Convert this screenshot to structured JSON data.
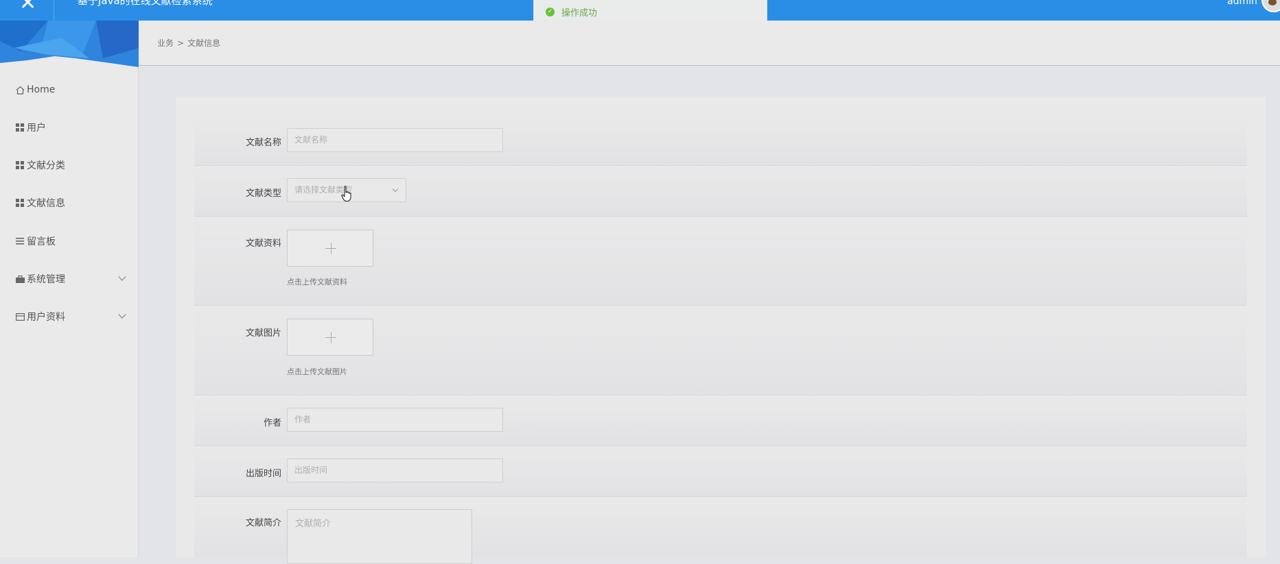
{
  "header": {
    "close_glyph": "✕",
    "app_title": "基于Java的在线文献检索系统",
    "user_name": "admin"
  },
  "toast": {
    "message": "操作成功"
  },
  "sidebar": {
    "items": [
      {
        "label": "Home",
        "icon": "home-icon"
      },
      {
        "label": "用户",
        "icon": "grid-icon"
      },
      {
        "label": "文献分类",
        "icon": "grid-icon"
      },
      {
        "label": "文献信息",
        "icon": "grid-icon"
      },
      {
        "label": "留言板",
        "icon": "list-icon"
      },
      {
        "label": "系统管理",
        "icon": "briefcase-icon",
        "expandable": true
      },
      {
        "label": "用户资料",
        "icon": "card-icon",
        "expandable": true
      }
    ]
  },
  "breadcrumb": {
    "parent": "业务",
    "separator": ">",
    "current": "文献信息"
  },
  "form": {
    "name": {
      "label": "文献名称",
      "placeholder": "文献名称"
    },
    "type": {
      "label": "文献类型",
      "placeholder": "请选择文献类型"
    },
    "file": {
      "label": "文献资料",
      "hint": "点击上传文献资料"
    },
    "image": {
      "label": "文献图片",
      "hint": "点击上传文献图片"
    },
    "author": {
      "label": "作者",
      "placeholder": "作者"
    },
    "publish_time": {
      "label": "出版时间",
      "placeholder": "出版时间"
    },
    "intro": {
      "label": "文献简介",
      "placeholder": "文献简介"
    }
  },
  "colors": {
    "topbar": "#2a8ee6",
    "success": "#67c23a"
  }
}
